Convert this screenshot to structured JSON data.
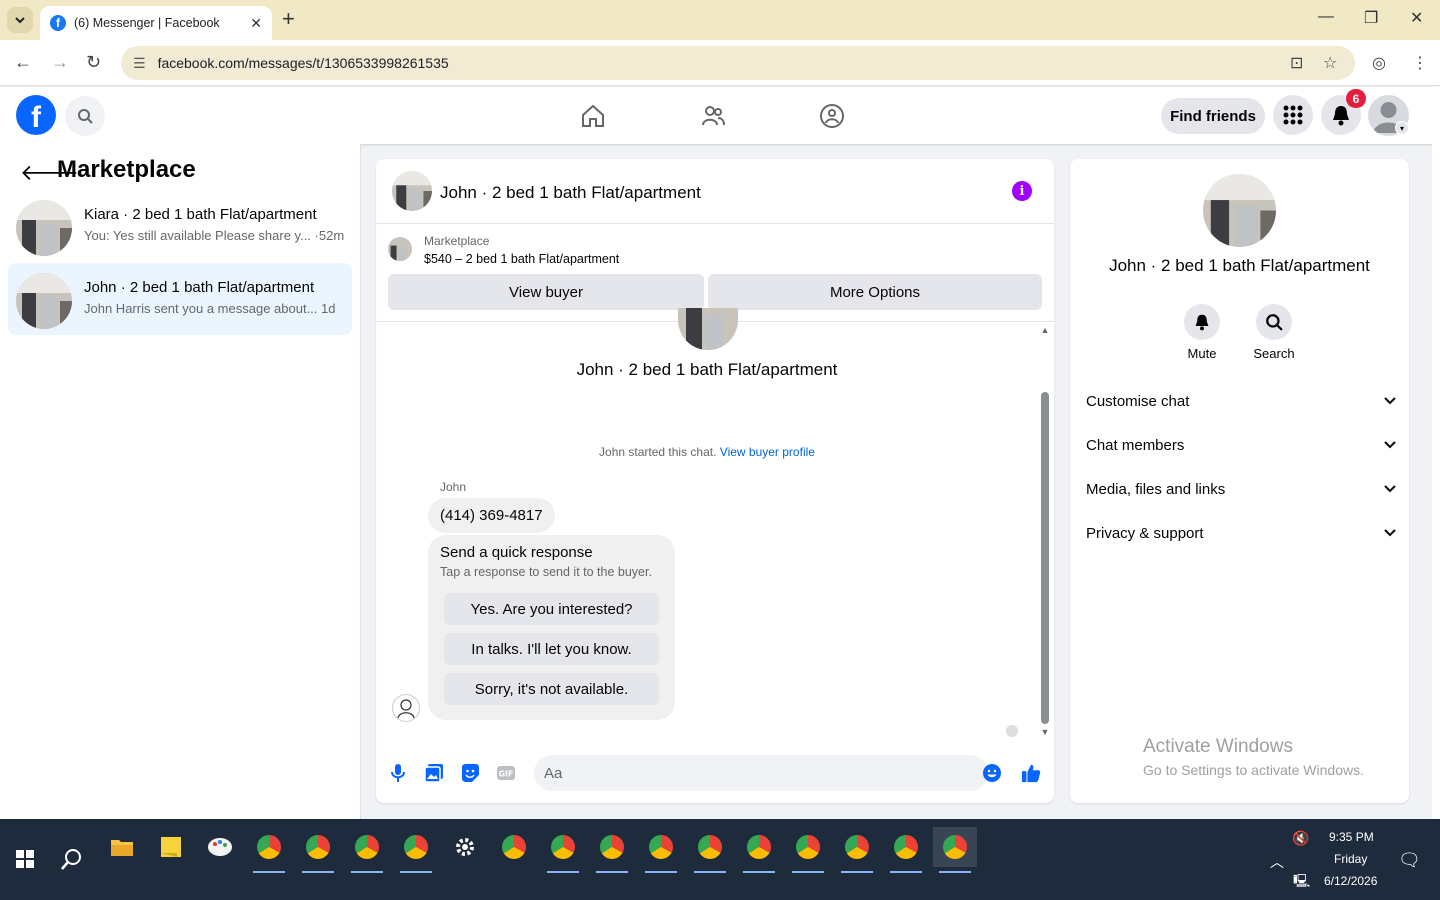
{
  "browser": {
    "tab_title": "(6) Messenger | Facebook",
    "url": "facebook.com/messages/t/1306533998261535"
  },
  "header": {
    "find_friends": "Find friends",
    "notification_count": "6"
  },
  "left": {
    "title": "Marketplace",
    "conversations": [
      {
        "name": "Kiara · 2 bed 1 bath Flat/apartment",
        "preview": "You: Yes still available Please share y... ·52m"
      },
      {
        "name": "John · 2 bed 1 bath Flat/apartment",
        "preview": "John Harris sent you a message about... 1d"
      }
    ]
  },
  "chat": {
    "title": "John · 2 bed 1 bath Flat/apartment",
    "listing_label": "Marketplace",
    "listing_price": "$540 – 2 bed 1 bath Flat/apartment",
    "view_buyer": "View buyer",
    "more_options": "More Options",
    "intro_name": "John · 2 bed 1 bath Flat/apartment",
    "started_text": "John started this chat.",
    "view_buyer_profile": "View buyer profile",
    "sender": "John",
    "message": "(414) 369-4817",
    "quick_title": "Send a quick response",
    "quick_sub": "Tap a response to send it to the buyer.",
    "quick_options": [
      "Yes. Are you interested?",
      "In talks. I'll let you know.",
      "Sorry, it's not available."
    ],
    "input_placeholder": "Aa"
  },
  "right": {
    "name": "John · 2 bed 1 bath Flat/apartment",
    "mute": "Mute",
    "search": "Search",
    "sections": [
      "Customise chat",
      "Chat members",
      "Media, files and links",
      "Privacy & support"
    ],
    "activate_title": "Activate Windows",
    "activate_sub": "Go to Settings to activate Windows."
  },
  "taskbar": {
    "time": "9:35 PM",
    "day": "Friday",
    "date": "6/12/2026"
  },
  "colors": {
    "facebook_blue": "#0866ff",
    "badge_red": "#e41e3f",
    "info_purple": "#a100ff",
    "link_blue": "#0064d1"
  }
}
